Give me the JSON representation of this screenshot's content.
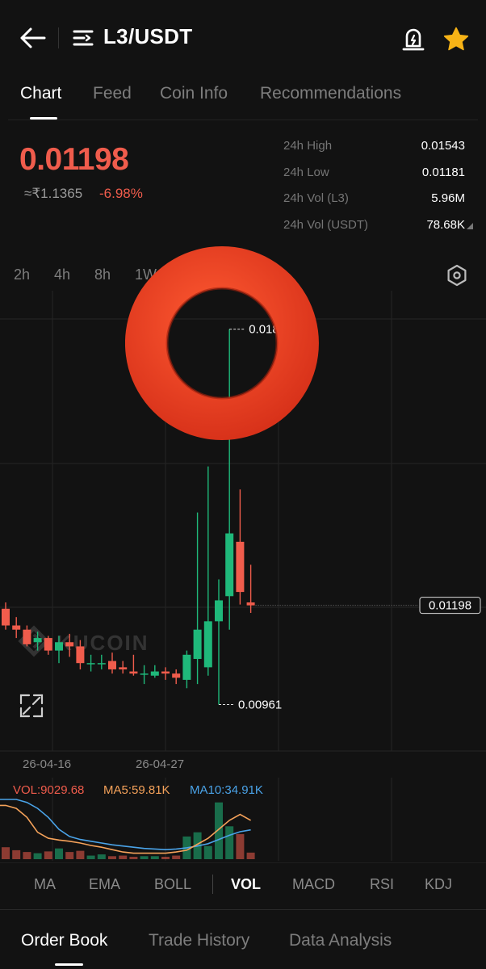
{
  "header": {
    "pair": "L3/USDT"
  },
  "tabs": [
    {
      "label": "Chart",
      "active": true
    },
    {
      "label": "Feed"
    },
    {
      "label": "Coin Info"
    },
    {
      "label": "Recommendations"
    }
  ],
  "ticker": {
    "price": "0.01198",
    "fiat": "≈₹1.1365",
    "change": "-6.98%",
    "stats": [
      {
        "label": "24h High",
        "value": "0.01543"
      },
      {
        "label": "24h Low",
        "value": "0.01181"
      },
      {
        "label": "24h Vol (L3)",
        "value": "5.96M"
      },
      {
        "label": "24h Vol (USDT)",
        "value": "78.68K"
      }
    ]
  },
  "periods": [
    "2h",
    "4h",
    "8h",
    "1W"
  ],
  "chart": {
    "watermark": "KUCOIN",
    "high_label": "0.01858",
    "low_label": "0.00961",
    "last_price": "0.01198",
    "ylim": [
      0.0085,
      0.0195
    ],
    "dates": [
      "26-04-16",
      "26-04-27"
    ],
    "up_color": "#1fb87a",
    "down_color": "#f05c4c",
    "candles": [
      {
        "o": 0.0119,
        "h": 0.01205,
        "l": 0.0114,
        "c": 0.0115
      },
      {
        "o": 0.0115,
        "h": 0.0117,
        "l": 0.0112,
        "c": 0.0114
      },
      {
        "o": 0.0114,
        "h": 0.0115,
        "l": 0.011,
        "c": 0.01105
      },
      {
        "o": 0.0111,
        "h": 0.01135,
        "l": 0.0109,
        "c": 0.0112
      },
      {
        "o": 0.0112,
        "h": 0.01125,
        "l": 0.0108,
        "c": 0.0109
      },
      {
        "o": 0.0109,
        "h": 0.01125,
        "l": 0.0106,
        "c": 0.0111
      },
      {
        "o": 0.0111,
        "h": 0.0113,
        "l": 0.01075,
        "c": 0.011
      },
      {
        "o": 0.011,
        "h": 0.01115,
        "l": 0.01045,
        "c": 0.0106
      },
      {
        "o": 0.0106,
        "h": 0.0108,
        "l": 0.0104,
        "c": 0.0106
      },
      {
        "o": 0.0106,
        "h": 0.0108,
        "l": 0.01045,
        "c": 0.0106
      },
      {
        "o": 0.01065,
        "h": 0.01085,
        "l": 0.01035,
        "c": 0.01045
      },
      {
        "o": 0.0105,
        "h": 0.01065,
        "l": 0.01035,
        "c": 0.01045
      },
      {
        "o": 0.0104,
        "h": 0.0108,
        "l": 0.0103,
        "c": 0.01035
      },
      {
        "o": 0.01035,
        "h": 0.01055,
        "l": 0.0101,
        "c": 0.01035
      },
      {
        "o": 0.0103,
        "h": 0.01055,
        "l": 0.01025,
        "c": 0.0104
      },
      {
        "o": 0.0104,
        "h": 0.0105,
        "l": 0.0102,
        "c": 0.01035
      },
      {
        "o": 0.01035,
        "h": 0.01045,
        "l": 0.0101,
        "c": 0.01025
      },
      {
        "o": 0.0102,
        "h": 0.0109,
        "l": 0.01,
        "c": 0.0108
      },
      {
        "o": 0.0107,
        "h": 0.0142,
        "l": 0.0101,
        "c": 0.0114
      },
      {
        "o": 0.0105,
        "h": 0.0153,
        "l": 0.0103,
        "c": 0.0116
      },
      {
        "o": 0.0116,
        "h": 0.0126,
        "l": 0.00961,
        "c": 0.0121
      },
      {
        "o": 0.0122,
        "h": 0.01858,
        "l": 0.0114,
        "c": 0.0137
      },
      {
        "o": 0.0135,
        "h": 0.01475,
        "l": 0.012,
        "c": 0.0123
      },
      {
        "o": 0.01205,
        "h": 0.01295,
        "l": 0.0118,
        "c": 0.01198
      }
    ]
  },
  "volume": {
    "vol_label": "VOL:9029.68",
    "ma5_label": "MA5:59.81K",
    "ma10_label": "MA10:34.91K",
    "ma5_color": "#f5a25a",
    "ma10_color": "#4aa3e8",
    "values": [
      2,
      1.5,
      1.2,
      1,
      1.3,
      1.8,
      1.2,
      1.4,
      0.6,
      0.8,
      0.5,
      0.6,
      0.4,
      0.5,
      0.5,
      0.4,
      0.6,
      3.8,
      4.5,
      2.2,
      9.5,
      5.5,
      4.2,
      1.1
    ],
    "ma5": [
      9,
      8.5,
      7,
      4.5,
      3.5,
      3.2,
      3,
      2.7,
      2.3,
      2,
      1.6,
      1.2,
      1,
      1,
      1,
      1,
      1.2,
      1.5,
      2.5,
      3.5,
      5,
      6.5,
      7.5,
      6.5
    ],
    "ma10": [
      10,
      10,
      9.5,
      8.5,
      7,
      5,
      3.8,
      3.3,
      3.0,
      2.7,
      2.4,
      2.2,
      2.0,
      1.8,
      1.7,
      1.6,
      1.7,
      1.9,
      2.2,
      2.6,
      3.3,
      4.0,
      4.6,
      4.9
    ]
  },
  "indicators": [
    {
      "label": "MA"
    },
    {
      "label": "EMA"
    },
    {
      "label": "BOLL"
    },
    {
      "label": "VOL",
      "active": true
    },
    {
      "label": "MACD"
    },
    {
      "label": "RSI"
    },
    {
      "label": "KDJ"
    }
  ],
  "bottom_tabs": [
    {
      "label": "Order Book",
      "active": true
    },
    {
      "label": "Trade History"
    },
    {
      "label": "Data Analysis"
    }
  ],
  "colors": {
    "ring": "#e23b1e"
  }
}
